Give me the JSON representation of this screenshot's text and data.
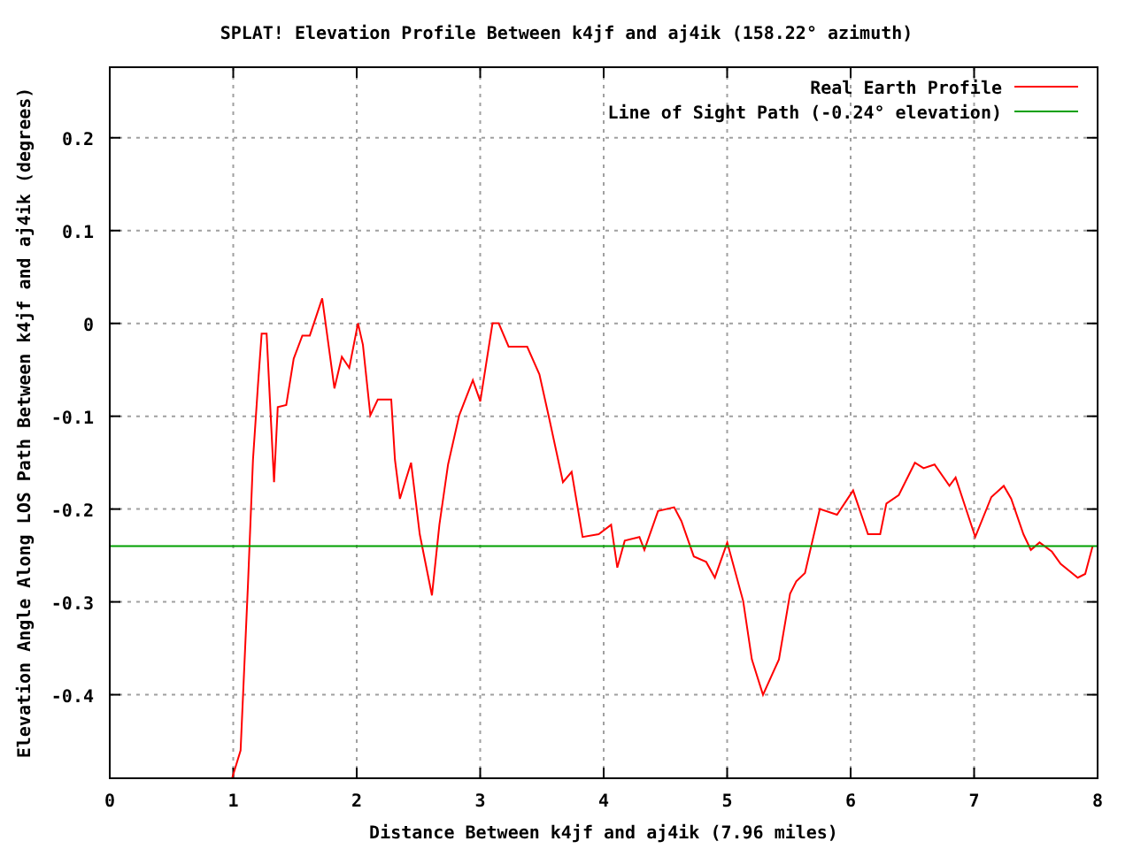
{
  "chart": {
    "chart_data": {
      "type": "line",
      "grid": true,
      "legend": true,
      "title": "SPLAT! Elevation Profile Between k4jf and aj4ik (158.22° azimuth)",
      "xlabel": "Distance Between k4jf and aj4ik (7.96 miles)",
      "ylabel": "Elevation Angle Along LOS Path Between k4jf and aj4ik (degrees)",
      "xlim": [
        0,
        8
      ],
      "ylim": [
        -0.49,
        0.276
      ],
      "xticks": [
        0,
        1,
        2,
        3,
        4,
        5,
        6,
        7,
        8
      ],
      "yticks": [
        {
          "value": -0.4,
          "label": "-0.4"
        },
        {
          "value": -0.3,
          "label": "-0.3"
        },
        {
          "value": -0.2,
          "label": "-0.2"
        },
        {
          "value": -0.1,
          "label": "-0.1"
        },
        {
          "value": 0,
          "label": "0"
        },
        {
          "value": 0.1,
          "label": "0.1"
        },
        {
          "value": 0.2,
          "label": "0.2"
        }
      ],
      "x": [
        0,
        0.99,
        1.06,
        1.12,
        1.16,
        1.2,
        1.23,
        1.27,
        1.33,
        1.36,
        1.43,
        1.49,
        1.56,
        1.62,
        1.72,
        1.82,
        1.88,
        1.94,
        2.01,
        2.05,
        2.11,
        2.17,
        2.28,
        2.31,
        2.35,
        2.44,
        2.51,
        2.61,
        2.67,
        2.74,
        2.83,
        2.94,
        3.0,
        3.1,
        3.15,
        3.23,
        3.38,
        3.48,
        3.56,
        3.67,
        3.74,
        3.83,
        3.96,
        4.06,
        4.11,
        4.17,
        4.29,
        4.33,
        4.44,
        4.57,
        4.63,
        4.73,
        4.83,
        4.9,
        5.0,
        5.13,
        5.2,
        5.29,
        5.42,
        5.51,
        5.56,
        5.63,
        5.75,
        5.89,
        6.02,
        6.14,
        6.24,
        6.29,
        6.39,
        6.52,
        6.59,
        6.68,
        6.8,
        6.85,
        7.01,
        7.14,
        7.24,
        7.3,
        7.4,
        7.46,
        7.53,
        7.63,
        7.7,
        7.84,
        7.9,
        7.96,
        8
      ],
      "series": [
        {
          "name": "Real Earth Profile",
          "color": "#ff0000",
          "values": [
            null,
            -0.49,
            -0.46,
            -0.28,
            -0.147,
            -0.067,
            -0.011,
            -0.011,
            -0.171,
            -0.09,
            -0.088,
            -0.038,
            -0.013,
            -0.013,
            0.027,
            -0.07,
            -0.036,
            -0.048,
            0,
            -0.023,
            -0.099,
            -0.082,
            -0.082,
            -0.147,
            -0.189,
            -0.15,
            -0.227,
            -0.293,
            -0.217,
            -0.152,
            -0.099,
            -0.061,
            -0.084,
            0,
            0,
            -0.025,
            -0.025,
            -0.055,
            -0.103,
            -0.171,
            -0.16,
            -0.23,
            -0.227,
            -0.217,
            -0.263,
            -0.234,
            -0.23,
            -0.244,
            -0.202,
            -0.198,
            -0.213,
            -0.251,
            -0.257,
            -0.274,
            -0.236,
            -0.299,
            -0.362,
            -0.4,
            -0.362,
            -0.291,
            -0.278,
            -0.269,
            -0.2,
            -0.206,
            -0.18,
            -0.227,
            -0.227,
            -0.194,
            -0.185,
            -0.15,
            -0.156,
            -0.152,
            -0.175,
            -0.166,
            -0.23,
            -0.187,
            -0.175,
            -0.189,
            -0.227,
            -0.244,
            -0.236,
            -0.246,
            -0.259,
            -0.274,
            -0.27,
            -0.24,
            null
          ]
        },
        {
          "name": "Line of Sight Path (-0.24° elevation)",
          "color": "#00a000",
          "values": [
            -0.24,
            -0.24,
            -0.24,
            -0.24,
            -0.24,
            -0.24,
            -0.24,
            -0.24,
            -0.24,
            -0.24,
            -0.24,
            -0.24,
            -0.24,
            -0.24,
            -0.24,
            -0.24,
            -0.24,
            -0.24,
            -0.24,
            -0.24,
            -0.24,
            -0.24,
            -0.24,
            -0.24,
            -0.24,
            -0.24,
            -0.24,
            -0.24,
            -0.24,
            -0.24,
            -0.24,
            -0.24,
            -0.24,
            -0.24,
            -0.24,
            -0.24,
            -0.24,
            -0.24,
            -0.24,
            -0.24,
            -0.24,
            -0.24,
            -0.24,
            -0.24,
            -0.24,
            -0.24,
            -0.24,
            -0.24,
            -0.24,
            -0.24,
            -0.24,
            -0.24,
            -0.24,
            -0.24,
            -0.24,
            -0.24,
            -0.24,
            -0.24,
            -0.24,
            -0.24,
            -0.24,
            -0.24,
            -0.24,
            -0.24,
            -0.24,
            -0.24,
            -0.24,
            -0.24,
            -0.24,
            -0.24,
            -0.24,
            -0.24,
            -0.24,
            -0.24,
            -0.24,
            -0.24,
            -0.24,
            -0.24,
            -0.24,
            -0.24,
            -0.24,
            -0.24,
            -0.24,
            -0.24,
            -0.24,
            -0.24,
            -0.24
          ]
        }
      ]
    }
  }
}
